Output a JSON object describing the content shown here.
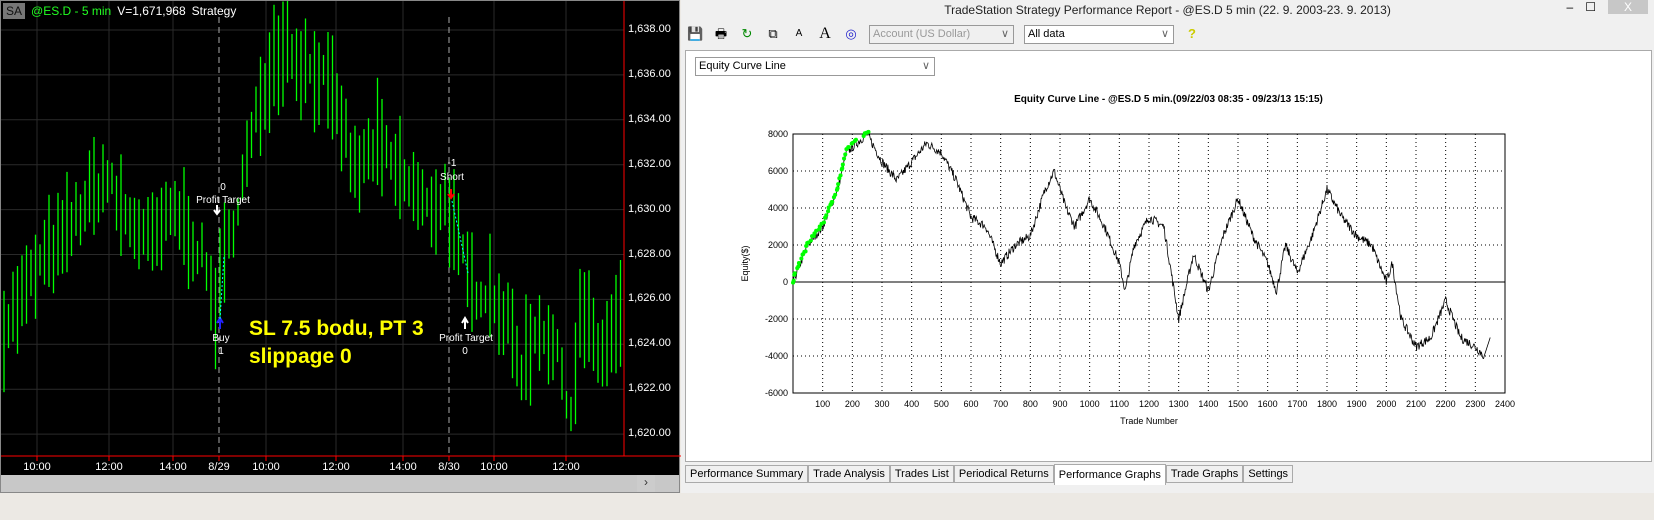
{
  "left_chart": {
    "window_tag": "SA",
    "symbol": "@ES.D - 5 min",
    "volume": "V=1,671,968",
    "type": "Strategy",
    "price_labels": [
      "1,638.00",
      "1,636.00",
      "1,634.00",
      "1,632.00",
      "1,630.00",
      "1,628.00",
      "1,626.00",
      "1,624.00",
      "1,622.00",
      "1,620.00"
    ],
    "price_values": [
      1638,
      1636,
      1634,
      1632,
      1630,
      1628,
      1626,
      1624,
      1622,
      1620
    ],
    "time_labels": [
      "10:00",
      "12:00",
      "14:00",
      "8/29",
      "10:00",
      "12:00",
      "14:00",
      "8/30",
      "10:00",
      "12:00"
    ],
    "price_path": [
      [
        0,
        1624.5
      ],
      [
        20,
        1626
      ],
      [
        45,
        1628
      ],
      [
        60,
        1628.5
      ],
      [
        80,
        1630
      ],
      [
        105,
        1631.5
      ],
      [
        120,
        1630
      ],
      [
        150,
        1628.5
      ],
      [
        175,
        1630
      ],
      [
        200,
        1628
      ],
      [
        215,
        1625.5
      ],
      [
        225,
        1628
      ],
      [
        240,
        1631
      ],
      [
        255,
        1634
      ],
      [
        270,
        1636.5
      ],
      [
        285,
        1637.5
      ],
      [
        300,
        1636.5
      ],
      [
        320,
        1636
      ],
      [
        340,
        1634
      ],
      [
        355,
        1631.5
      ],
      [
        375,
        1633
      ],
      [
        390,
        1632
      ],
      [
        410,
        1631
      ],
      [
        425,
        1630
      ],
      [
        445,
        1630.5
      ],
      [
        460,
        1628
      ],
      [
        470,
        1626.5
      ],
      [
        490,
        1626.5
      ],
      [
        510,
        1624.5
      ],
      [
        520,
        1623
      ],
      [
        540,
        1625
      ],
      [
        560,
        1623
      ],
      [
        570,
        1621
      ],
      [
        580,
        1625.5
      ],
      [
        600,
        1623.5
      ],
      [
        620,
        1625
      ]
    ],
    "annotations": {
      "pt1_qty": "0",
      "pt1_label": "Profit Target",
      "buy_label": "Buy",
      "buy_qty": "1",
      "short_qty": "-1",
      "short_label": "Short",
      "pt2_label": "Profit Target",
      "pt2_qty": "0"
    },
    "note_line1": "SL 7.5 bodu, PT 3",
    "note_line2": "slippage 0",
    "colors": {
      "bar": "#00ff00",
      "axis": "#ff0000",
      "note": "#ffff00"
    }
  },
  "report": {
    "title": "TradeStation Strategy Performance Report - @ES.D 5 min (22. 9. 2003-23. 9. 2013)",
    "account_select": "Account (US Dollar)",
    "range_select": "All data",
    "graph_select": "Equity Curve Line",
    "tabs": [
      "Performance Summary",
      "Trade Analysis",
      "Trades List",
      "Periodical Returns",
      "Performance Graphs",
      "Trade Graphs",
      "Settings"
    ],
    "active_tab": "Performance Graphs"
  },
  "chart_data": {
    "type": "line",
    "title": "Equity Curve Line - @ES.D 5 min.(09/22/03 08:35 - 09/23/13 15:15)",
    "xlabel": "Trade Number",
    "ylabel": "Equity($)",
    "xlim": [
      0,
      2400
    ],
    "ylim": [
      -6000,
      8000
    ],
    "x_ticks": [
      100,
      200,
      300,
      400,
      500,
      600,
      700,
      800,
      900,
      1000,
      1100,
      1200,
      1300,
      1400,
      1500,
      1600,
      1700,
      1800,
      1900,
      2000,
      2100,
      2200,
      2300,
      2400
    ],
    "y_ticks": [
      8000,
      6000,
      4000,
      2000,
      0,
      -2000,
      -4000,
      -6000
    ],
    "grid": true,
    "new_high_color": "#00ff00",
    "line_color": "#000000",
    "points": [
      [
        0,
        0
      ],
      [
        50,
        2000
      ],
      [
        100,
        3000
      ],
      [
        150,
        5000
      ],
      [
        180,
        7000
      ],
      [
        250,
        8000
      ],
      [
        300,
        6500
      ],
      [
        350,
        5500
      ],
      [
        400,
        6500
      ],
      [
        450,
        7500
      ],
      [
        500,
        7000
      ],
      [
        550,
        5500
      ],
      [
        600,
        3500
      ],
      [
        650,
        3000
      ],
      [
        700,
        1000
      ],
      [
        750,
        2000
      ],
      [
        800,
        2500
      ],
      [
        850,
        5000
      ],
      [
        880,
        6000
      ],
      [
        920,
        4000
      ],
      [
        950,
        3000
      ],
      [
        1000,
        4500
      ],
      [
        1050,
        3000
      ],
      [
        1100,
        1000
      ],
      [
        1120,
        -500
      ],
      [
        1150,
        2000
      ],
      [
        1200,
        3500
      ],
      [
        1250,
        3000
      ],
      [
        1300,
        -2000
      ],
      [
        1350,
        1500
      ],
      [
        1400,
        -500
      ],
      [
        1450,
        2500
      ],
      [
        1500,
        4500
      ],
      [
        1550,
        2500
      ],
      [
        1600,
        1000
      ],
      [
        1630,
        -500
      ],
      [
        1660,
        2000
      ],
      [
        1700,
        500
      ],
      [
        1750,
        2500
      ],
      [
        1800,
        5000
      ],
      [
        1850,
        3500
      ],
      [
        1900,
        2500
      ],
      [
        1950,
        2000
      ],
      [
        2000,
        0
      ],
      [
        2020,
        1000
      ],
      [
        2050,
        -2000
      ],
      [
        2100,
        -3500
      ],
      [
        2150,
        -3000
      ],
      [
        2200,
        -1000
      ],
      [
        2250,
        -3000
      ],
      [
        2300,
        -3500
      ],
      [
        2330,
        -4000
      ],
      [
        2350,
        -3000
      ]
    ]
  }
}
